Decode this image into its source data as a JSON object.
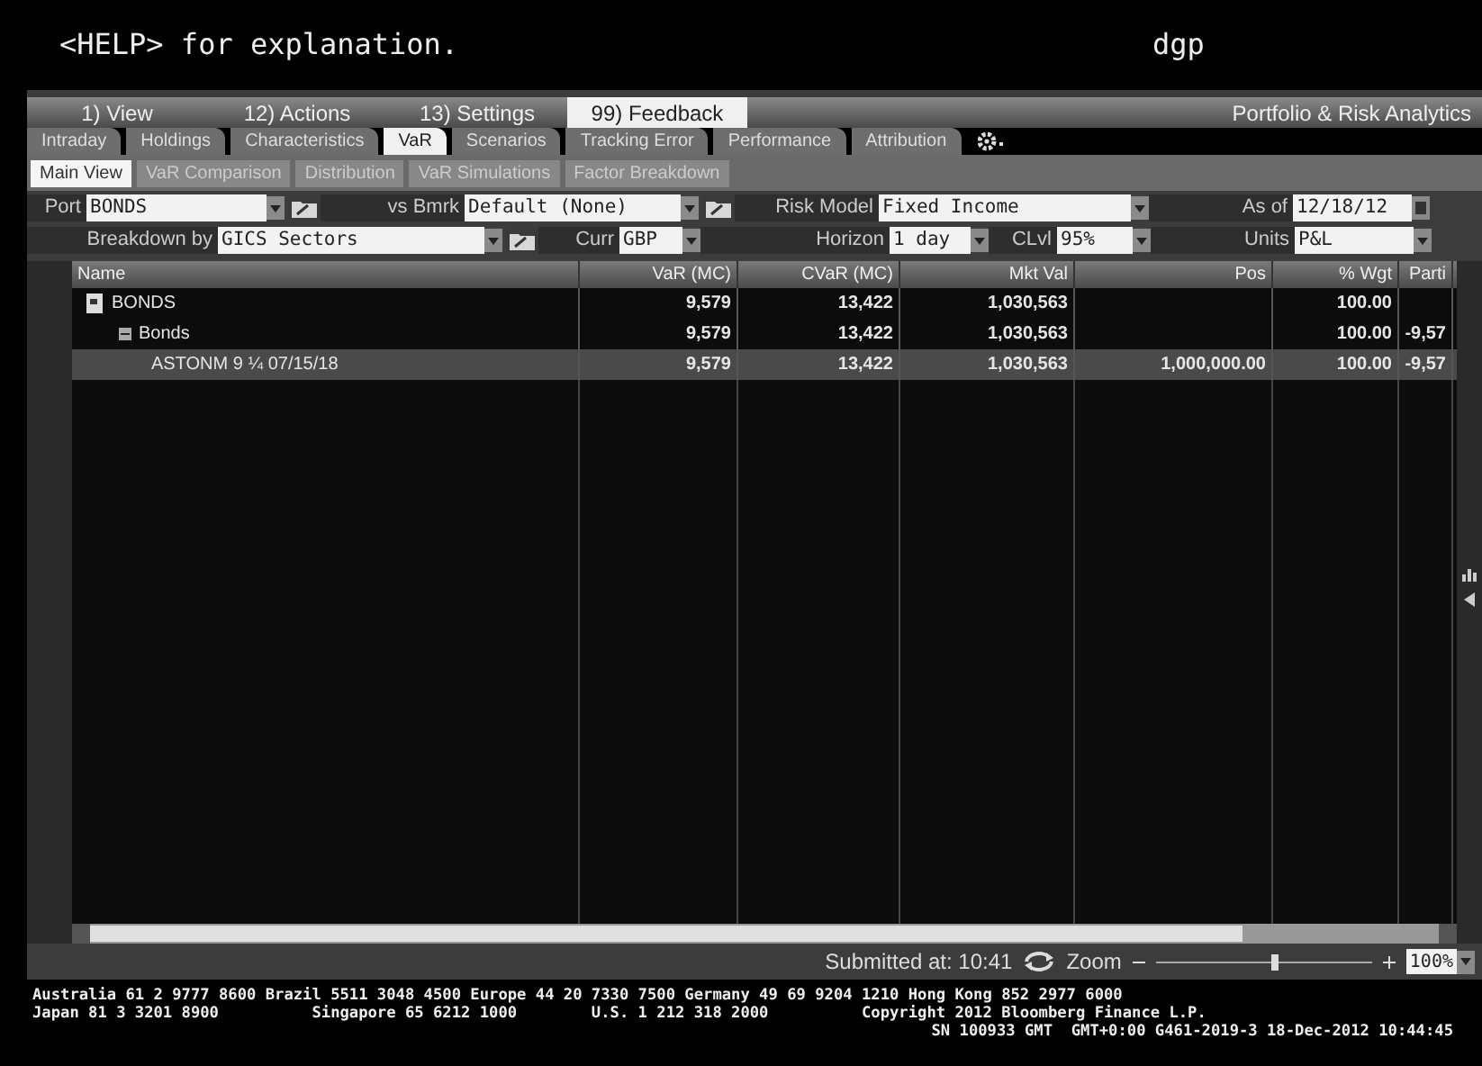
{
  "header": {
    "help_text": "<HELP> for explanation.",
    "user": "dgp"
  },
  "menu": [
    {
      "label": "1) View",
      "selected": false
    },
    {
      "label": "12) Actions",
      "selected": false
    },
    {
      "label": "13) Settings",
      "selected": false
    },
    {
      "label": "99) Feedback",
      "selected": true
    }
  ],
  "app_title": "Portfolio & Risk Analytics",
  "tabs": [
    {
      "label": "Intraday",
      "selected": false
    },
    {
      "label": "Holdings",
      "selected": false
    },
    {
      "label": "Characteristics",
      "selected": false
    },
    {
      "label": "VaR",
      "selected": true
    },
    {
      "label": "Scenarios",
      "selected": false
    },
    {
      "label": "Tracking Error",
      "selected": false
    },
    {
      "label": "Performance",
      "selected": false
    },
    {
      "label": "Attribution",
      "selected": false
    }
  ],
  "subtabs": [
    {
      "label": "Main View",
      "selected": true
    },
    {
      "label": "VaR Comparison",
      "selected": false
    },
    {
      "label": "Distribution",
      "selected": false
    },
    {
      "label": "VaR Simulations",
      "selected": false
    },
    {
      "label": "Factor Breakdown",
      "selected": false
    }
  ],
  "filters": [
    [
      {
        "kind": "label",
        "text": "Port"
      },
      {
        "kind": "select",
        "value": "BONDS",
        "folder": true
      },
      {
        "kind": "label",
        "text": "vs Bmrk"
      },
      {
        "kind": "select",
        "value": "Default (None)",
        "folder": true
      },
      {
        "kind": "label",
        "text": "Risk Model"
      },
      {
        "kind": "select",
        "value": "Fixed Income",
        "folder": false
      },
      {
        "kind": "label",
        "text": "As of"
      },
      {
        "kind": "date",
        "value": "12/18/12",
        "folder": false
      }
    ],
    [
      {
        "kind": "label",
        "text": "Breakdown by"
      },
      {
        "kind": "select",
        "value": "GICS Sectors",
        "folder": true
      },
      {
        "kind": "label",
        "text": "Curr"
      },
      {
        "kind": "select",
        "value": "GBP",
        "folder": false
      },
      {
        "kind": "label",
        "text": "Horizon"
      },
      {
        "kind": "select",
        "value": "1 day",
        "folder": false
      },
      {
        "kind": "label",
        "text": "CLvl"
      },
      {
        "kind": "select",
        "value": "95%",
        "folder": false
      },
      {
        "kind": "label",
        "text": "Units"
      },
      {
        "kind": "select",
        "value": "P&L",
        "folder": false
      }
    ]
  ],
  "table": {
    "columns": [
      "Name",
      "VaR (MC)",
      "CVaR (MC)",
      "Mkt Val",
      "Pos",
      "% Wgt",
      "Parti"
    ],
    "rows": [
      {
        "cells": [
          "BONDS",
          "9,579",
          "13,422",
          "1,030,563",
          "",
          "100.00",
          ""
        ],
        "selected": false,
        "children": [
          {
            "cells": [
              "Bonds",
              "9,579",
              "13,422",
              "1,030,563",
              "",
              "100.00",
              "-9,57"
            ],
            "selected": false,
            "children": [
              {
                "cells": [
                  "ASTONM 9 ¼ 07/15/18",
                  "9,579",
                  "13,422",
                  "1,030,563",
                  "1,000,000.00",
                  "100.00",
                  "-9,57"
                ],
                "selected": true
              }
            ]
          }
        ]
      }
    ]
  },
  "status": {
    "submitted": "Submitted at: 10:41",
    "zoom_label": "Zoom",
    "level": 0.55,
    "zoom_value": "100%"
  },
  "footer": [
    "Australia 61 2 9777 8600 Brazil 5511 3048 4500 Europe 44 20 7330 7500 Germany 49 69 9204 1210 Hong Kong 852 2977 6000",
    "Japan 81 3 3201 8900          Singapore 65 6212 1000        U.S. 1 212 318 2000          Copyright 2012 Bloomberg Finance L.P.",
    "SN 100933 GMT  GMT+0:00 G461-2019-3 18-Dec-2012 10:44:45"
  ]
}
